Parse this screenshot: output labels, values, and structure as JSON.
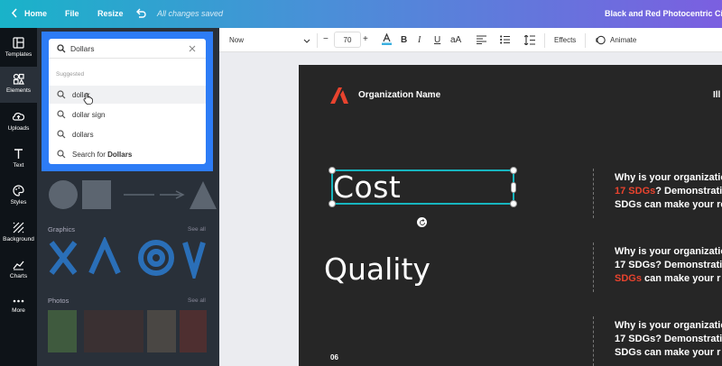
{
  "topbar": {
    "home": "Home",
    "file": "File",
    "resize": "Resize",
    "saved": "All changes saved",
    "doc_title": "Black and Red Photocentric Civil S"
  },
  "rail": [
    {
      "label": "Templates",
      "icon": "templates-icon"
    },
    {
      "label": "Elements",
      "icon": "elements-icon"
    },
    {
      "label": "Uploads",
      "icon": "upload-icon"
    },
    {
      "label": "Text",
      "icon": "text-icon"
    },
    {
      "label": "Styles",
      "icon": "palette-icon"
    },
    {
      "label": "Background",
      "icon": "background-icon"
    },
    {
      "label": "Charts",
      "icon": "chart-icon"
    },
    {
      "label": "More",
      "icon": "more-icon"
    }
  ],
  "search": {
    "value": "Dollars",
    "suggested_label": "Suggested",
    "suggestions": [
      "dollar",
      "dollar sign",
      "dollars"
    ],
    "search_for_prefix": "Search for ",
    "search_for_term": "Dollars"
  },
  "panel": {
    "graphics_label": "Graphics",
    "photos_label": "Photos",
    "see_all": "See all"
  },
  "toolbar": {
    "font": "Now",
    "size": "70",
    "minus": "−",
    "plus": "+",
    "effects": "Effects",
    "animate": "Animate"
  },
  "slide": {
    "org": "Organization Name",
    "corner": "Ill",
    "cost": "Cost",
    "quality": "Quality",
    "page": "06",
    "accent": "#e8432e",
    "row1": {
      "l1": "Why is your organizatio",
      "hl": "17 SDGs",
      "l2rest": "? Demonstrati",
      "l3": "SDGs can make your re"
    },
    "row2": {
      "l1": "Why is your organizatio",
      "l2": "17 SDGs? Demonstrati",
      "hl": "SDGs",
      "l3rest": " can make your r"
    },
    "row3": {
      "l1": "Why is your organizatio",
      "l2": "17 SDGs? Demonstrati",
      "l3": "SDGs can make your r"
    }
  }
}
